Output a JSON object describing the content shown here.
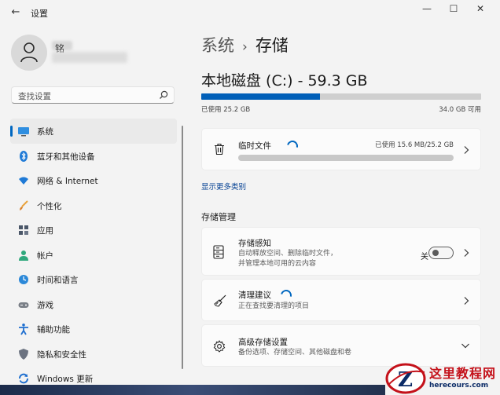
{
  "window": {
    "title": "设置",
    "back_glyph": "←",
    "minimize_glyph": "—",
    "maximize_glyph": "☐",
    "close_glyph": "✕"
  },
  "profile": {
    "name": "铭"
  },
  "search": {
    "placeholder": "查找设置"
  },
  "sidebar": {
    "items": [
      {
        "label": "系统",
        "icon": "monitor-icon",
        "active": true
      },
      {
        "label": "蓝牙和其他设备",
        "icon": "bluetooth-icon"
      },
      {
        "label": "网络 & Internet",
        "icon": "wifi-icon"
      },
      {
        "label": "个性化",
        "icon": "brush-icon"
      },
      {
        "label": "应用",
        "icon": "apps-icon"
      },
      {
        "label": "帐户",
        "icon": "person-icon"
      },
      {
        "label": "时间和语言",
        "icon": "globe-clock-icon"
      },
      {
        "label": "游戏",
        "icon": "gamepad-icon"
      },
      {
        "label": "辅助功能",
        "icon": "accessibility-icon"
      },
      {
        "label": "隐私和安全性",
        "icon": "shield-icon"
      },
      {
        "label": "Windows 更新",
        "icon": "update-icon"
      }
    ]
  },
  "breadcrumb": {
    "parent": "系统",
    "separator": "›",
    "current": "存储"
  },
  "disk": {
    "title": "本地磁盘 (C:) - 59.3 GB",
    "used_label": "已使用 25.2 GB",
    "free_label": "34.0 GB 可用",
    "used_fraction": 0.425
  },
  "temp_files": {
    "title": "临时文件",
    "usage": "已使用 15.6 MB/25.2 GB",
    "usage_fraction": 0.0006
  },
  "more_categories_link": "显示更多类别",
  "storage_management": {
    "heading": "存储管理",
    "storage_sense": {
      "title": "存储感知",
      "description_line1": "自动释放空间、删除临时文件，",
      "description_line2": "并管理本地可用的云内容",
      "toggle_label": "关",
      "toggle_on": false
    },
    "cleanup": {
      "title": "清理建议",
      "description": "正在查找要清理的项目"
    },
    "advanced": {
      "title": "高级存储设置",
      "description": "备份选项、存储空间、其他磁盘和卷"
    }
  },
  "watermark": {
    "title": "这里教程网",
    "url": "herecours.com"
  },
  "colors": {
    "accent": "#0067c0",
    "disk_fill": "#005fb8",
    "watermark_red": "#c4111a"
  }
}
